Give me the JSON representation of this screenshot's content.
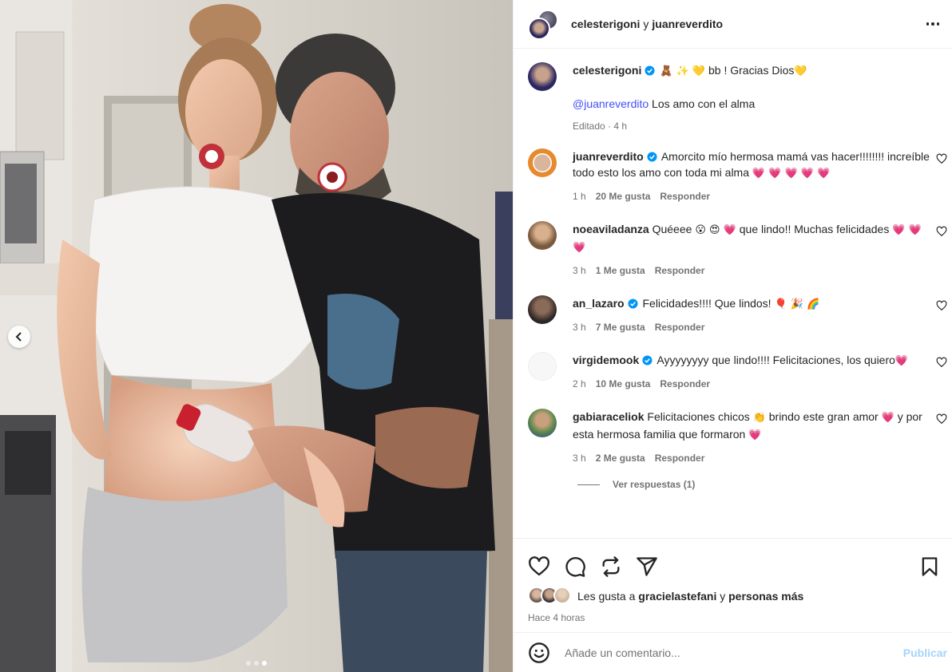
{
  "post": {
    "header": {
      "user1": "celesterigoni",
      "conj": "y",
      "user2": "juanreverdito"
    },
    "caption": {
      "username": "celesterigoni",
      "emojis": "🧸 ✨ 💛",
      "text": "bb ! Gracias Dios",
      "text_emoji": "💛",
      "mention": "@juanreverdito",
      "line2": "Los amo con el alma",
      "edited": "Editado · 4 h"
    },
    "comments": [
      {
        "username": "juanreverdito",
        "verified": true,
        "text": "Amorcito mío hermosa mamá vas hacer!!!!!!!! increíble todo esto los amo con toda mi alma",
        "emoji": "💗 💗 💗 💗 💗",
        "time": "1 h",
        "likes": "20 Me gusta",
        "reply": "Responder"
      },
      {
        "username": "noeaviladanza",
        "verified": false,
        "text": "Quéeee",
        "emoji": "😮 😍 💗",
        "text2": "que lindo!! Muchas felicidades",
        "emoji2": "💗 💗 💗",
        "time": "3 h",
        "likes": "1 Me gusta",
        "reply": "Responder"
      },
      {
        "username": "an_lazaro",
        "verified": true,
        "text": "Felicidades!!!! Que lindos!",
        "emoji": "🎈 🎉 🌈",
        "time": "3 h",
        "likes": "7 Me gusta",
        "reply": "Responder"
      },
      {
        "username": "virgidemook",
        "verified": true,
        "text": "Ayyyyyyyy que lindo!!!! Felicitaciones, los quiero",
        "emoji": "💗",
        "time": "2 h",
        "likes": "10 Me gusta",
        "reply": "Responder"
      },
      {
        "username": "gabiaraceliok",
        "verified": false,
        "text": "Felicitaciones chicos",
        "emoji": "👏",
        "text2": "brindo este gran amor",
        "emoji2": "💗",
        "text3": "y por esta hermosa familia que formaron",
        "emoji3": "💗",
        "time": "3 h",
        "likes": "2 Me gusta",
        "reply": "Responder"
      }
    ],
    "view_replies": "Ver respuestas (1)",
    "likes_line": {
      "prefix": "Les gusta a",
      "user": "gracielastefani",
      "conj": "y",
      "others": "personas más"
    },
    "time_ago": "Hace 4 horas",
    "add_comment": {
      "placeholder": "Añade un comentario...",
      "publish": "Publicar"
    },
    "carousel": {
      "slides": 3,
      "active": 3
    }
  },
  "icons": [
    "heart-icon",
    "comment-icon",
    "repost-icon",
    "share-icon",
    "bookmark-icon",
    "smiley-icon",
    "verified-icon",
    "chevron-left-icon",
    "more-icon"
  ],
  "colors": {
    "link": "#4150f7",
    "verified": "#0095f6",
    "publish_disabled": "#a5d4fd",
    "secondary": "#737373"
  }
}
